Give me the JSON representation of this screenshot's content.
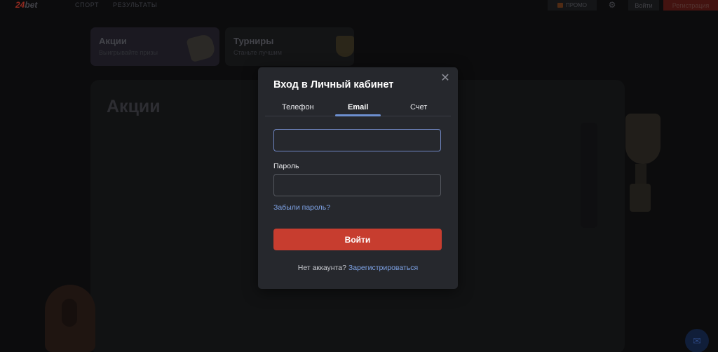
{
  "header": {
    "logo_main": "24",
    "logo_suffix": "bet",
    "nav": [
      "СПОРТ",
      "РЕЗУЛЬТАТЫ"
    ],
    "promo_label": "ПРОМО",
    "login_label": "Войти",
    "register_label": "Регистрация"
  },
  "cards": [
    {
      "title": "Акции",
      "subtitle": "Выигрывайте призы"
    },
    {
      "title": "Турниры",
      "subtitle": "Станьте лучшим"
    }
  ],
  "panel": {
    "title": "Акции"
  },
  "modal": {
    "title": "Вход в Личный кабинет",
    "close_glyph": "✕",
    "tabs": [
      {
        "label": "Телефон",
        "active": false
      },
      {
        "label": "Email",
        "active": true
      },
      {
        "label": "Счет",
        "active": false
      }
    ],
    "email": {
      "value": "",
      "placeholder": ""
    },
    "password": {
      "label": "Пароль",
      "value": "",
      "placeholder": ""
    },
    "forgot_label": "Забыли пароль?",
    "submit_label": "Войти",
    "no_account_text": "Нет аккаунта?",
    "register_link": "Зарегистрироваться"
  },
  "colors": {
    "accent_red": "#c73d2f",
    "link_blue": "#7ea3e6",
    "modal_bg": "#26282d",
    "tab_underline": "#6d8fd0"
  },
  "icons": {
    "close": "close-icon",
    "settings": "gear-icon",
    "promo": "gift-icon",
    "chat": "chat-icon"
  }
}
